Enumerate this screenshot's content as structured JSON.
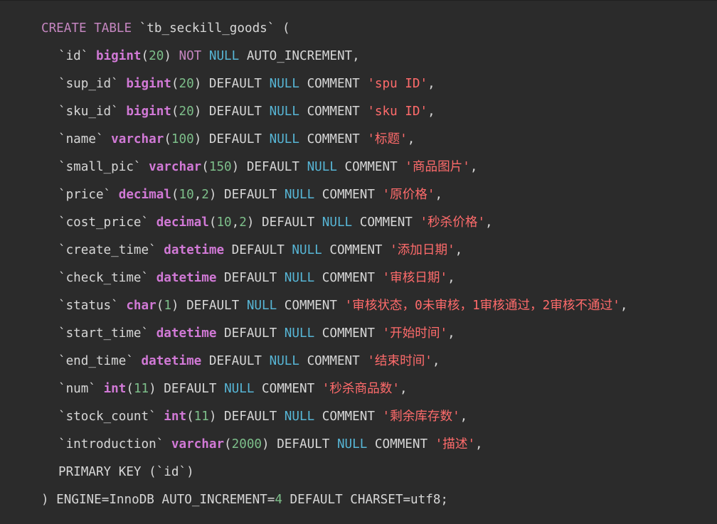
{
  "colors": {
    "background": "#2b2b2b",
    "plain": "#d7d7d7",
    "keyword": "#c586c0",
    "type": "#d179d6",
    "number": "#7dbf8a",
    "string": "#ff6b6b",
    "null": "#57b6d6"
  },
  "code": {
    "lines": [
      {
        "indent": 0,
        "tokens": [
          {
            "t": "CREATE TABLE",
            "k": "kw"
          },
          {
            "t": " `tb_seckill_goods` (",
            "k": "plain"
          }
        ]
      },
      {
        "indent": 1,
        "tokens": [
          {
            "t": "`id` ",
            "k": "plain"
          },
          {
            "t": "bigint",
            "k": "ty"
          },
          {
            "t": "(",
            "k": "plain"
          },
          {
            "t": "20",
            "k": "num"
          },
          {
            "t": ") ",
            "k": "plain"
          },
          {
            "t": "NOT",
            "k": "kw"
          },
          {
            "t": " ",
            "k": "plain"
          },
          {
            "t": "NULL",
            "k": "null"
          },
          {
            "t": " AUTO_INCREMENT,",
            "k": "plain"
          }
        ]
      },
      {
        "indent": 1,
        "tokens": [
          {
            "t": "`sup_id` ",
            "k": "plain"
          },
          {
            "t": "bigint",
            "k": "ty"
          },
          {
            "t": "(",
            "k": "plain"
          },
          {
            "t": "20",
            "k": "num"
          },
          {
            "t": ") DEFAULT ",
            "k": "plain"
          },
          {
            "t": "NULL",
            "k": "null"
          },
          {
            "t": " COMMENT ",
            "k": "plain"
          },
          {
            "t": "'spu ID'",
            "k": "str"
          },
          {
            "t": ",",
            "k": "plain"
          }
        ]
      },
      {
        "indent": 1,
        "tokens": [
          {
            "t": "`sku_id` ",
            "k": "plain"
          },
          {
            "t": "bigint",
            "k": "ty"
          },
          {
            "t": "(",
            "k": "plain"
          },
          {
            "t": "20",
            "k": "num"
          },
          {
            "t": ") DEFAULT ",
            "k": "plain"
          },
          {
            "t": "NULL",
            "k": "null"
          },
          {
            "t": " COMMENT ",
            "k": "plain"
          },
          {
            "t": "'sku ID'",
            "k": "str"
          },
          {
            "t": ",",
            "k": "plain"
          }
        ]
      },
      {
        "indent": 1,
        "tokens": [
          {
            "t": "`name` ",
            "k": "plain"
          },
          {
            "t": "varchar",
            "k": "ty"
          },
          {
            "t": "(",
            "k": "plain"
          },
          {
            "t": "100",
            "k": "num"
          },
          {
            "t": ") DEFAULT ",
            "k": "plain"
          },
          {
            "t": "NULL",
            "k": "null"
          },
          {
            "t": " COMMENT ",
            "k": "plain"
          },
          {
            "t": "'标题'",
            "k": "str"
          },
          {
            "t": ",",
            "k": "plain"
          }
        ]
      },
      {
        "indent": 1,
        "tokens": [
          {
            "t": "`small_pic` ",
            "k": "plain"
          },
          {
            "t": "varchar",
            "k": "ty"
          },
          {
            "t": "(",
            "k": "plain"
          },
          {
            "t": "150",
            "k": "num"
          },
          {
            "t": ") DEFAULT ",
            "k": "plain"
          },
          {
            "t": "NULL",
            "k": "null"
          },
          {
            "t": " COMMENT ",
            "k": "plain"
          },
          {
            "t": "'商品图片'",
            "k": "str"
          },
          {
            "t": ",",
            "k": "plain"
          }
        ]
      },
      {
        "indent": 1,
        "tokens": [
          {
            "t": "`price` ",
            "k": "plain"
          },
          {
            "t": "decimal",
            "k": "ty"
          },
          {
            "t": "(",
            "k": "plain"
          },
          {
            "t": "10",
            "k": "num"
          },
          {
            "t": ",",
            "k": "plain"
          },
          {
            "t": "2",
            "k": "num"
          },
          {
            "t": ") DEFAULT ",
            "k": "plain"
          },
          {
            "t": "NULL",
            "k": "null"
          },
          {
            "t": " COMMENT ",
            "k": "plain"
          },
          {
            "t": "'原价格'",
            "k": "str"
          },
          {
            "t": ",",
            "k": "plain"
          }
        ]
      },
      {
        "indent": 1,
        "tokens": [
          {
            "t": "`cost_price` ",
            "k": "plain"
          },
          {
            "t": "decimal",
            "k": "ty"
          },
          {
            "t": "(",
            "k": "plain"
          },
          {
            "t": "10",
            "k": "num"
          },
          {
            "t": ",",
            "k": "plain"
          },
          {
            "t": "2",
            "k": "num"
          },
          {
            "t": ") DEFAULT ",
            "k": "plain"
          },
          {
            "t": "NULL",
            "k": "null"
          },
          {
            "t": " COMMENT ",
            "k": "plain"
          },
          {
            "t": "'秒杀价格'",
            "k": "str"
          },
          {
            "t": ",",
            "k": "plain"
          }
        ]
      },
      {
        "indent": 1,
        "tokens": [
          {
            "t": "`create_time` ",
            "k": "plain"
          },
          {
            "t": "datetime",
            "k": "ty"
          },
          {
            "t": " DEFAULT ",
            "k": "plain"
          },
          {
            "t": "NULL",
            "k": "null"
          },
          {
            "t": " COMMENT ",
            "k": "plain"
          },
          {
            "t": "'添加日期'",
            "k": "str"
          },
          {
            "t": ",",
            "k": "plain"
          }
        ]
      },
      {
        "indent": 1,
        "tokens": [
          {
            "t": "`check_time` ",
            "k": "plain"
          },
          {
            "t": "datetime",
            "k": "ty"
          },
          {
            "t": " DEFAULT ",
            "k": "plain"
          },
          {
            "t": "NULL",
            "k": "null"
          },
          {
            "t": " COMMENT ",
            "k": "plain"
          },
          {
            "t": "'审核日期'",
            "k": "str"
          },
          {
            "t": ",",
            "k": "plain"
          }
        ]
      },
      {
        "indent": 1,
        "tokens": [
          {
            "t": "`status` ",
            "k": "plain"
          },
          {
            "t": "char",
            "k": "ty"
          },
          {
            "t": "(",
            "k": "plain"
          },
          {
            "t": "1",
            "k": "num"
          },
          {
            "t": ") DEFAULT ",
            "k": "plain"
          },
          {
            "t": "NULL",
            "k": "null"
          },
          {
            "t": " COMMENT ",
            "k": "plain"
          },
          {
            "t": "'审核状态，0未审核，1审核通过，2审核不通过'",
            "k": "str"
          },
          {
            "t": ",",
            "k": "plain"
          }
        ]
      },
      {
        "indent": 1,
        "tokens": [
          {
            "t": "`start_time` ",
            "k": "plain"
          },
          {
            "t": "datetime",
            "k": "ty"
          },
          {
            "t": " DEFAULT ",
            "k": "plain"
          },
          {
            "t": "NULL",
            "k": "null"
          },
          {
            "t": " COMMENT ",
            "k": "plain"
          },
          {
            "t": "'开始时间'",
            "k": "str"
          },
          {
            "t": ",",
            "k": "plain"
          }
        ]
      },
      {
        "indent": 1,
        "tokens": [
          {
            "t": "`end_time` ",
            "k": "plain"
          },
          {
            "t": "datetime",
            "k": "ty"
          },
          {
            "t": " DEFAULT ",
            "k": "plain"
          },
          {
            "t": "NULL",
            "k": "null"
          },
          {
            "t": " COMMENT ",
            "k": "plain"
          },
          {
            "t": "'结束时间'",
            "k": "str"
          },
          {
            "t": ",",
            "k": "plain"
          }
        ]
      },
      {
        "indent": 1,
        "tokens": [
          {
            "t": "`num` ",
            "k": "plain"
          },
          {
            "t": "int",
            "k": "ty"
          },
          {
            "t": "(",
            "k": "plain"
          },
          {
            "t": "11",
            "k": "num"
          },
          {
            "t": ") DEFAULT ",
            "k": "plain"
          },
          {
            "t": "NULL",
            "k": "null"
          },
          {
            "t": " COMMENT ",
            "k": "plain"
          },
          {
            "t": "'秒杀商品数'",
            "k": "str"
          },
          {
            "t": ",",
            "k": "plain"
          }
        ]
      },
      {
        "indent": 1,
        "tokens": [
          {
            "t": "`stock_count` ",
            "k": "plain"
          },
          {
            "t": "int",
            "k": "ty"
          },
          {
            "t": "(",
            "k": "plain"
          },
          {
            "t": "11",
            "k": "num"
          },
          {
            "t": ") DEFAULT ",
            "k": "plain"
          },
          {
            "t": "NULL",
            "k": "null"
          },
          {
            "t": " COMMENT ",
            "k": "plain"
          },
          {
            "t": "'剩余库存数'",
            "k": "str"
          },
          {
            "t": ",",
            "k": "plain"
          }
        ]
      },
      {
        "indent": 1,
        "tokens": [
          {
            "t": "`introduction` ",
            "k": "plain"
          },
          {
            "t": "varchar",
            "k": "ty"
          },
          {
            "t": "(",
            "k": "plain"
          },
          {
            "t": "2000",
            "k": "num"
          },
          {
            "t": ") DEFAULT ",
            "k": "plain"
          },
          {
            "t": "NULL",
            "k": "null"
          },
          {
            "t": " COMMENT ",
            "k": "plain"
          },
          {
            "t": "'描述'",
            "k": "str"
          },
          {
            "t": ",",
            "k": "plain"
          }
        ]
      },
      {
        "indent": 1,
        "tokens": [
          {
            "t": "PRIMARY KEY (`id`)",
            "k": "plain"
          }
        ]
      },
      {
        "indent": 0,
        "tokens": [
          {
            "t": ") ENGINE=InnoDB AUTO_INCREMENT=",
            "k": "plain"
          },
          {
            "t": "4",
            "k": "num"
          },
          {
            "t": " DEFAULT CHARSET=utf8;",
            "k": "plain"
          }
        ]
      }
    ]
  }
}
